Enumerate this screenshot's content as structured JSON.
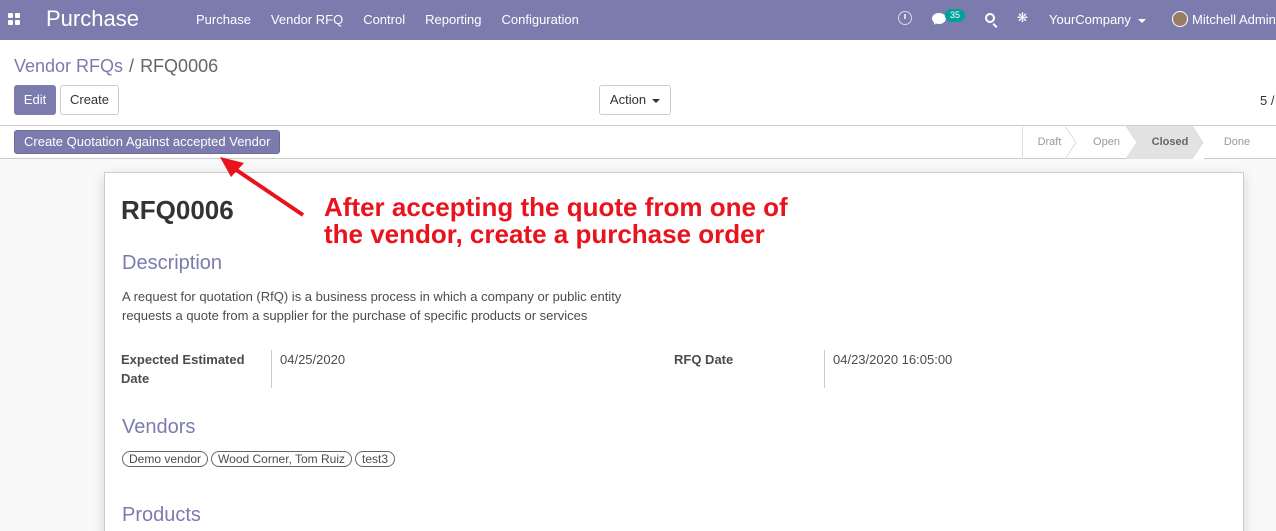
{
  "navbar": {
    "app_title": "Purchase",
    "menu": [
      "Purchase",
      "Vendor RFQ",
      "Control",
      "Reporting",
      "Configuration"
    ],
    "notification_count": "35",
    "company": "YourCompany",
    "user": "Mitchell Admin",
    "bar_color": "#7c7bad"
  },
  "control_panel": {
    "breadcrumb_parent": "Vendor RFQs",
    "breadcrumb_separator": "/",
    "breadcrumb_current": "RFQ0006",
    "edit_label": "Edit",
    "create_label": "Create",
    "action_label": "Action",
    "pager": "5 /"
  },
  "statusbar": {
    "quote_button": "Create Quotation Against accepted Vendor",
    "stages": [
      "Draft",
      "Open",
      "Closed",
      "Done"
    ],
    "active_stage": "Closed"
  },
  "sheet": {
    "title": "RFQ0006",
    "description_heading": "Description",
    "description_line1": "A request for quotation (RfQ) is a business process in which a company or public entity",
    "description_line2": "requests a quote from a supplier for the purchase of specific products or services",
    "expected_label_line1": "Expected Estimated",
    "expected_label_line2": "Date",
    "expected_value": "04/25/2020",
    "rfq_date_label": "RFQ Date",
    "rfq_date_value": "04/23/2020 16:05:00",
    "vendors_heading": "Vendors",
    "vendors": [
      "Demo vendor",
      "Wood Corner, Tom Ruiz",
      "test3"
    ],
    "products_heading": "Products"
  },
  "annotation": {
    "line1": "After accepting the quote from one of",
    "line2": "the vendor, create a purchase order",
    "color": "#e8131c"
  }
}
